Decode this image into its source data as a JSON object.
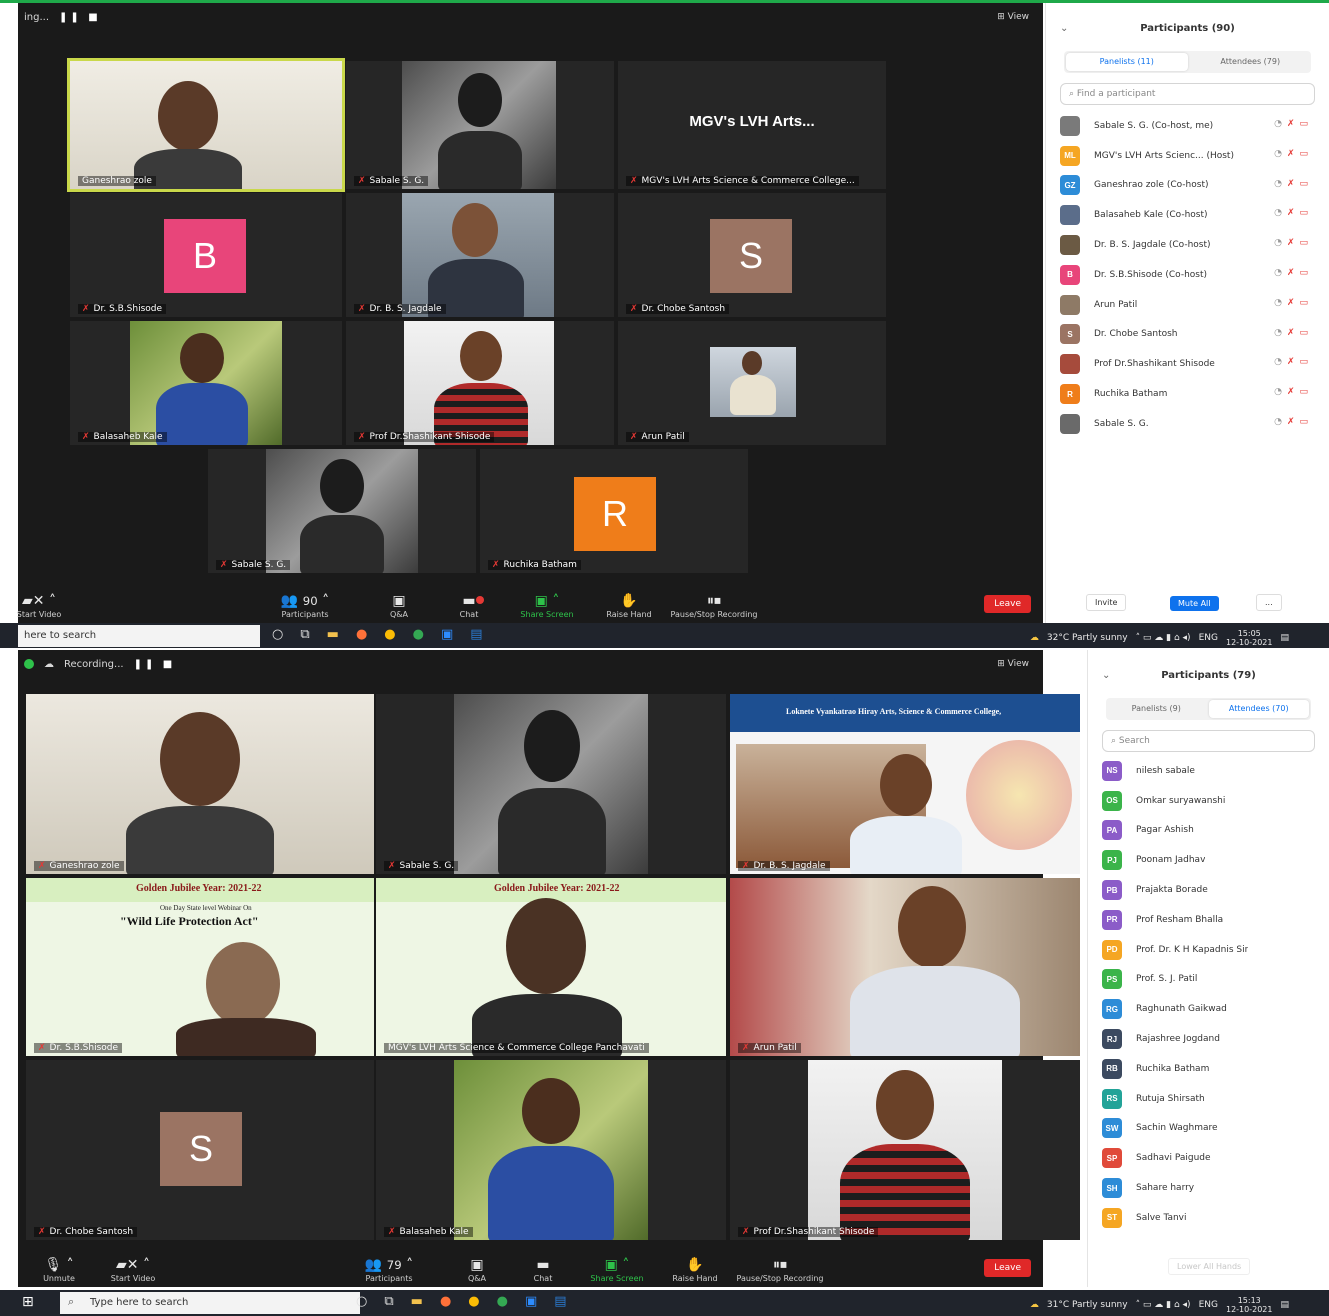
{
  "screen1": {
    "title_fragment": "ing...",
    "view_label": "View",
    "tiles": [
      {
        "name": "Ganeshrao zole",
        "kind": "video"
      },
      {
        "name": "Sabale S. G.",
        "kind": "video"
      },
      {
        "name": "MGV's LVH Arts Science & Commerce College...",
        "kind": "text",
        "display": "MGV's LVH Arts..."
      },
      {
        "name": "Dr. S.B.Shisode",
        "kind": "avatar",
        "letter": "B"
      },
      {
        "name": "Dr. B. S. Jagdale",
        "kind": "video"
      },
      {
        "name": "Dr. Chobe Santosh",
        "kind": "avatar",
        "letter": "S"
      },
      {
        "name": "Balasaheb Kale",
        "kind": "video"
      },
      {
        "name": "Prof Dr.Shashikant Shisode",
        "kind": "video"
      },
      {
        "name": "Arun Patil",
        "kind": "video"
      },
      {
        "name": "Sabale S. G.",
        "kind": "video"
      },
      {
        "name": "Ruchika Batham",
        "kind": "avatar",
        "letter": "R"
      }
    ],
    "toolbar": {
      "start_video": "Start Video",
      "participants": "Participants",
      "participants_count": "90",
      "qa": "Q&A",
      "chat": "Chat",
      "share": "Share Screen",
      "raise": "Raise Hand",
      "rec": "Pause/Stop Recording",
      "leave": "Leave"
    },
    "panel": {
      "title": "Participants (90)",
      "tab_panelists": "Panelists (11)",
      "tab_attendees": "Attendees (79)",
      "search_placeholder": "Find a participant",
      "invite": "Invite",
      "mute_all": "Mute All",
      "more": "...",
      "rows": [
        {
          "initials": "",
          "name": "Sabale S. G. (Co-host, me)",
          "color": "#7a7a7a"
        },
        {
          "initials": "ML",
          "name": "MGV's LVH Arts Scienc... (Host)",
          "color": "#f5a623"
        },
        {
          "initials": "GZ",
          "name": "Ganeshrao zole (Co-host)",
          "color": "#2d8cd7"
        },
        {
          "initials": "",
          "name": "Balasaheb Kale (Co-host)",
          "color": "#5b6d8a"
        },
        {
          "initials": "",
          "name": "Dr. B. S. Jagdale (Co-host)",
          "color": "#6b5a44"
        },
        {
          "initials": "B",
          "name": "Dr. S.B.Shisode (Co-host)",
          "color": "#e8457a"
        },
        {
          "initials": "",
          "name": "Arun Patil",
          "color": "#8e7a66"
        },
        {
          "initials": "S",
          "name": "Dr. Chobe Santosh",
          "color": "#9b7463"
        },
        {
          "initials": "",
          "name": "Prof Dr.Shashikant Shisode",
          "color": "#a64b3c"
        },
        {
          "initials": "R",
          "name": "Ruchika Batham",
          "color": "#ef7d1a"
        },
        {
          "initials": "",
          "name": "Sabale S. G.",
          "color": "#6a6a6a"
        }
      ]
    },
    "taskbar": {
      "search": "here to search",
      "weather": "32°C  Partly sunny",
      "lang": "ENG",
      "time": "15:05",
      "date": "12-10-2021"
    }
  },
  "screen2": {
    "recording_label": "Recording...",
    "view_label": "View",
    "tiles": [
      {
        "name": "Ganeshrao zole"
      },
      {
        "name": "Sabale S. G."
      },
      {
        "name": "Dr. B. S. Jagdale"
      },
      {
        "name": "Dr. S.B.Shisode"
      },
      {
        "name": "MGV's LVH Arts Science & Commerce College Panchavati"
      },
      {
        "name": "Arun Patil"
      },
      {
        "name": "Dr. Chobe Santosh",
        "letter": "S"
      },
      {
        "name": "Balasaheb Kale"
      },
      {
        "name": "Prof Dr.Shashikant Shisode"
      }
    ],
    "banner": {
      "college": "Loknete Vyankatrao Hiray Arts, Science & Commerce College,",
      "jubilee": "Golden Jubilee Year: 2021-22",
      "webinar_sub": "One Day State level Webinar On",
      "webinar_title": "\"Wild Life Protection Act\""
    },
    "toolbar": {
      "unmute": "Unmute",
      "start_video": "Start Video",
      "participants": "Participants",
      "participants_count": "79",
      "qa": "Q&A",
      "chat": "Chat",
      "share": "Share Screen",
      "raise": "Raise Hand",
      "rec": "Pause/Stop Recording",
      "leave": "Leave"
    },
    "panel": {
      "title": "Participants (79)",
      "tab_panelists": "Panelists (9)",
      "tab_attendees": "Attendees (70)",
      "search_placeholder": "Search",
      "lower_hands": "Lower All Hands",
      "rows": [
        {
          "initials": "NS",
          "name": "nilesh sabale",
          "color": "#8b5cc8"
        },
        {
          "initials": "OS",
          "name": "Omkar suryawanshi",
          "color": "#3bb44a"
        },
        {
          "initials": "PA",
          "name": "Pagar Ashish",
          "color": "#8b5cc8"
        },
        {
          "initials": "PJ",
          "name": "Poonam Jadhav",
          "color": "#3bb44a"
        },
        {
          "initials": "PB",
          "name": "Prajakta Borade",
          "color": "#8b5cc8"
        },
        {
          "initials": "PR",
          "name": "Prof Resham Bhalla",
          "color": "#8b5cc8"
        },
        {
          "initials": "PD",
          "name": "Prof. Dr. K H Kapadnis Sir",
          "color": "#f5a623"
        },
        {
          "initials": "PS",
          "name": "Prof. S. J. Patil",
          "color": "#3bb44a"
        },
        {
          "initials": "RG",
          "name": "Raghunath Gaikwad",
          "color": "#2d8cd7"
        },
        {
          "initials": "RJ",
          "name": "Rajashree Jogdand",
          "color": "#3c4a60"
        },
        {
          "initials": "RB",
          "name": "Ruchika Batham",
          "color": "#3c4a60"
        },
        {
          "initials": "RS",
          "name": "Rutuja Shirsath",
          "color": "#22a398"
        },
        {
          "initials": "SW",
          "name": "Sachin Waghmare",
          "color": "#2d8cd7"
        },
        {
          "initials": "SP",
          "name": "Sadhavi Paigude",
          "color": "#e04a3a"
        },
        {
          "initials": "SH",
          "name": "Sahare harry",
          "color": "#2d8cd7"
        },
        {
          "initials": "ST",
          "name": "Salve Tanvi",
          "color": "#f5a623"
        }
      ]
    },
    "taskbar": {
      "search": "Type here to search",
      "weather": "31°C  Partly sunny",
      "lang": "ENG",
      "time": "15:13",
      "date": "12-10-2021"
    }
  },
  "colors": {
    "avatar_b": "#e8457a",
    "avatar_s": "#9b7463",
    "avatar_r": "#ef7d1a",
    "zoom_blue": "#0e72ed",
    "leave_red": "#e02828",
    "share_green": "#2ec24a"
  }
}
